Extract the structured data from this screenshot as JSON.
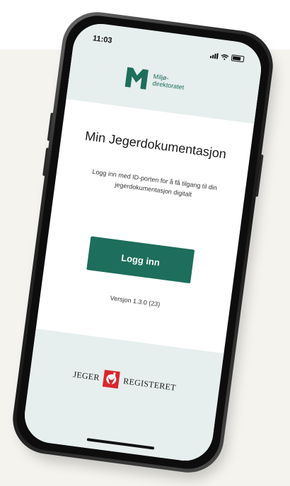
{
  "status_bar": {
    "time": "11:03"
  },
  "header": {
    "logo_line1": "Miljø-",
    "logo_line2": "direktoratet"
  },
  "main": {
    "title": "Min Jegerdokumentasjon",
    "subtitle": "Logg inn med ID-porten for å få tilgang til din jegerdokumentasjon digitalt",
    "login_button_label": "Logg inn",
    "version": "Versjon 1.3.0 (23)"
  },
  "footer": {
    "brand_left": "JEGER",
    "brand_right": "REGISTERET"
  },
  "colors": {
    "brand_green": "#1d6e5c",
    "header_bg": "#e6eeee",
    "jeger_red": "#d8262c",
    "backdrop": "#f5f3ee"
  }
}
